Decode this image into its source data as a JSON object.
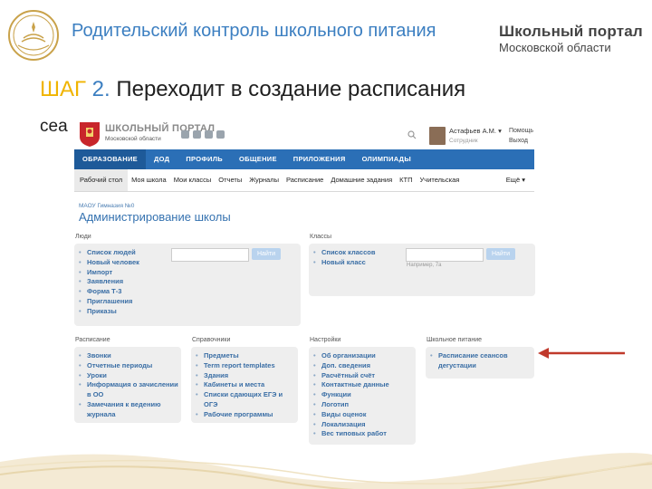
{
  "slide": {
    "title": "Родительский контроль школьного питания",
    "brand_line1": "Школьный портал",
    "brand_line2": "Московской области",
    "step_word": "ШАГ",
    "step_num": "2.",
    "step_text": " Переходит в создание расписания",
    "step_text_cont": "сеа"
  },
  "header": {
    "site_name": "ШКОЛЬНЫЙ ПОРТАЛ",
    "site_sub": "Московской области",
    "user_name": "Астафьев А.М. ▾",
    "user_role": "Сотрудник",
    "help": "Помощь",
    "logout": "Выход"
  },
  "nav": [
    "ОБРАЗОВАНИЕ",
    "ДОД",
    "ПРОФИЛЬ",
    "ОБЩЕНИЕ",
    "ПРИЛОЖЕНИЯ",
    "ОЛИМПИАДЫ"
  ],
  "subnav": [
    "Рабочий стол",
    "Моя школа",
    "Мои классы",
    "Отчеты",
    "Журналы",
    "Расписание",
    "Домашние задания",
    "КТП",
    "Учительская"
  ],
  "subnav_more": "Ещё ▾",
  "breadcrumb": "МАОУ Гимназия №0",
  "page_title": "Администрирование школы",
  "sections": {
    "people": {
      "label": "Люди",
      "items": [
        "Список людей",
        "Новый человек",
        "Импорт",
        "Заявления",
        "Форма Т-3",
        "Приглашения",
        "Приказы"
      ],
      "button": "Найти"
    },
    "classes": {
      "label": "Классы",
      "items": [
        "Список классов",
        "Новый класс"
      ],
      "button": "Найти",
      "hint": "Например, 7а"
    },
    "schedule": {
      "label": "Расписание",
      "items": [
        "Звонки",
        "Отчетные периоды",
        "Уроки",
        "Информация о зачислении в ОО",
        "Замечания к ведению журнала"
      ]
    },
    "reference": {
      "label": "Справочники",
      "items": [
        "Предметы",
        "Term report templates",
        "Здания",
        "Кабинеты и места",
        "Списки сдающих ЕГЭ и ОГЭ",
        "Рабочие программы"
      ]
    },
    "settings": {
      "label": "Настройки",
      "items": [
        "Об организации",
        "Доп. сведения",
        "Расчётный счёт",
        "Контактные данные",
        "Функции",
        "Логотип",
        "Виды оценок",
        "Локализация",
        "Вес типовых работ"
      ]
    },
    "food": {
      "label": "Школьное питание",
      "items": [
        "Расписание сеансов дегустации"
      ]
    }
  },
  "colors": {
    "accent_blue": "#2b6fb6",
    "title_blue": "#3c7fc1",
    "step_yellow": "#f0b400",
    "arrow_red": "#c0392b"
  }
}
